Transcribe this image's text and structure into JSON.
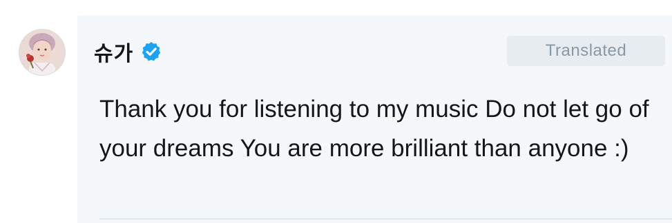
{
  "post": {
    "author": {
      "display_name": "슈가",
      "verified": true,
      "verified_icon": "verified-badge-icon",
      "avatar_icon": "avatar"
    },
    "translation": {
      "label": "Translated"
    },
    "text": "Thank you for listening to my music Do not let go of your dreams You are more brilliant than anyone :)"
  },
  "colors": {
    "card_background": "#f5f8fa",
    "text": "#14171a",
    "verified_blue": "#1da1f2",
    "pill_background": "#e6ecf0",
    "pill_text": "#8899a6",
    "divider": "#e1e8ed"
  }
}
